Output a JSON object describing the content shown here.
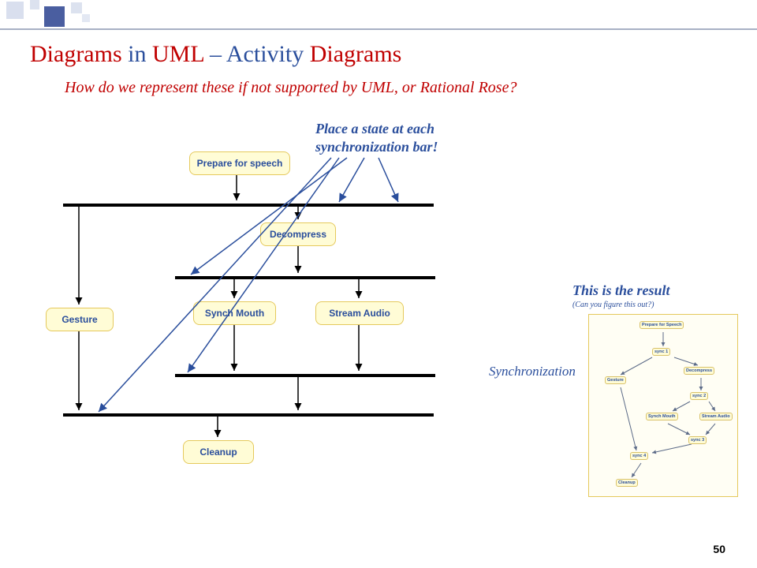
{
  "title": {
    "w1": "Diagrams",
    "w2": "in",
    "w3": "UML",
    "w4": "– Activity",
    "w5": "Diagrams"
  },
  "question": "How do we represent these if not supported by UML, or Rational Rose?",
  "tip_l1": "Place a state at each",
  "tip_l2": "synchronization bar!",
  "result_title": "This is the result",
  "result_sub": "(Can you figure this out?)",
  "sync_label": "Synchronization",
  "activities": {
    "prepare": "Prepare for speech",
    "decompress": "Decompress",
    "gesture": "Gesture",
    "synch_mouth": "Synch Mouth",
    "stream_audio": "Stream Audio",
    "cleanup": "Cleanup"
  },
  "mini": {
    "prepare": "Prepare for Speech",
    "sync1": "sync 1",
    "gesture": "Gesture",
    "decompress": "Decompress",
    "sync2": "sync 2",
    "synch_mouth": "Synch Mouth",
    "stream_audio": "Stream Audio",
    "sync3": "sync 3",
    "sync4": "sync 4",
    "cleanup": "Cleanup"
  },
  "page": "50"
}
